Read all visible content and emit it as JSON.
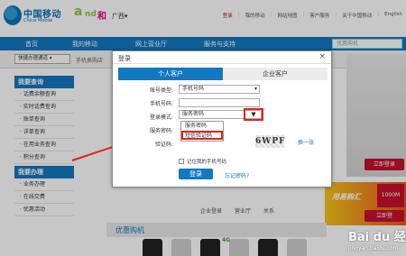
{
  "header": {
    "logo_cn": "中国移动",
    "logo_en": "China Mobile",
    "andhe_logo": "and和",
    "province": "广西",
    "top_links": [
      {
        "label": "登录",
        "highlight": true
      },
      {
        "label": "我的移动",
        "highlight": false
      },
      {
        "label": "网站地图",
        "highlight": false
      },
      {
        "label": "客户服务",
        "highlight": false
      },
      {
        "label": "关于中国移动",
        "highlight": false
      },
      {
        "label": "English",
        "highlight": false
      }
    ]
  },
  "nav": {
    "home": "首页",
    "mine": "我的移动",
    "hall": "网上营业厅",
    "service": "服务与支持",
    "search_placeholder": "优惠购机"
  },
  "subbar": {
    "select_value": "快捷办理通道",
    "hint": "手机换购店"
  },
  "sidebar": {
    "section1": "我要查询",
    "items1": [
      "话费余额查询",
      "实时话费查询",
      "账单查询",
      "详单查询",
      "在用业务查询",
      "积分查询"
    ],
    "active_index": 4,
    "section2": "我要办理",
    "items2": [
      "业务办理",
      "在线交费",
      "优惠活动"
    ]
  },
  "right": {
    "btn1": "立即登录",
    "promo": "用易购汇",
    "promo_badge": "1000M",
    "btn2": "立即登"
  },
  "bottom": {
    "links": [
      "企业登录",
      "营业厅",
      "关系"
    ],
    "deal_title": "优惠购机",
    "tag": "4G"
  },
  "dialog": {
    "title": "登录",
    "close": "×",
    "tabs": [
      {
        "label": "个人客户",
        "active": true
      },
      {
        "label": "企业客户",
        "active": false
      }
    ],
    "account_type_label": "账号类型:",
    "account_type_value": "手机号码",
    "phone_label": "手机号码:",
    "phone_value": "",
    "login_mode_label": "登录模式:",
    "login_mode_value": "服务密码",
    "password_label": "服务密码:",
    "captcha_label": "验证码:",
    "dropdown_options": [
      "服务密码",
      "短信验证码"
    ],
    "selected_option_index": 1,
    "captcha_text": "6WPF",
    "change_link": "换一张",
    "remember": "记住我的手机号码",
    "login_button": "登录",
    "forgot": "忘记密码?"
  },
  "watermark": {
    "brand": "Bai du 经验",
    "url": "jingyan.baidu.com"
  },
  "colors": {
    "brand_blue": "#1178c2",
    "highlight_red": "#e2231a"
  }
}
